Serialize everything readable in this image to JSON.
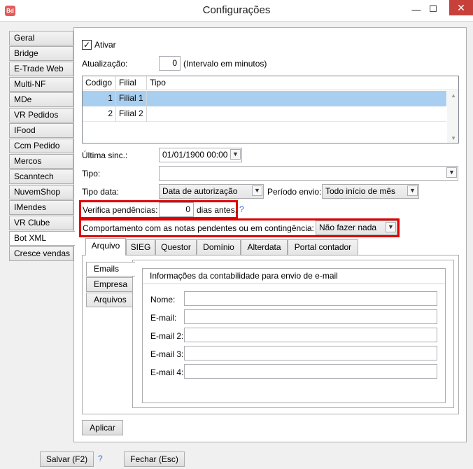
{
  "window": {
    "title": "Configurações",
    "icon_text": "Bd",
    "minimize_glyph": "—",
    "maximize_glyph": "☐",
    "close_glyph": "✕"
  },
  "nav": {
    "items": [
      "Geral",
      "Bridge",
      "E-Trade Web",
      "Multi-NF",
      "MDe",
      "VR Pedidos",
      "IFood",
      "Ccm Pedido",
      "Mercos",
      "Scanntech",
      "NuvemShop",
      "IMendes",
      "VR Clube",
      "Bot XML",
      "Cresce vendas"
    ],
    "active": "Bot XML"
  },
  "form": {
    "ativar_label": "Ativar",
    "ativar_checked": true,
    "check_glyph": "✓",
    "atualizacao_label": "Atualização:",
    "atualizacao_value": "0",
    "atualizacao_hint": "(Intervalo em minutos)",
    "grid": {
      "columns": [
        "Codigo",
        "Filial",
        "Tipo"
      ],
      "rows": [
        {
          "codigo": "1",
          "filial": "Filial 1",
          "tipo": ""
        },
        {
          "codigo": "2",
          "filial": "Filial 2",
          "tipo": ""
        }
      ],
      "selected_row": 0
    },
    "ultima_sinc_label": "Última sinc.:",
    "ultima_sinc_value": "01/01/1900 00:00",
    "tipo_label": "Tipo:",
    "tipo_value": "",
    "tipo_data_label": "Tipo data:",
    "tipo_data_value": "Data de autorização",
    "periodo_envio_label": "Período envio:",
    "periodo_envio_value": "Todo início de mês",
    "verifica_label": "Verifica pendências:",
    "verifica_value": "0",
    "verifica_suffix": "dias antes.",
    "help_glyph": "?",
    "comportamento_label": "Comportamento com as notas pendentes ou em contingência:",
    "comportamento_value": "Não fazer nada",
    "dropdown_glyph": "▼"
  },
  "subtabs": {
    "items": [
      "Arquivo",
      "SIEG",
      "Questor",
      "Domínio",
      "Alterdata",
      "Portal contador"
    ],
    "active": "Arquivo"
  },
  "vtabs": {
    "items": [
      "Emails",
      "Empresa",
      "Arquivos"
    ],
    "active": "Emails"
  },
  "email_group": {
    "title": "Informações da contabilidade para envio de e-mail",
    "fields": [
      {
        "label": "Nome:",
        "value": ""
      },
      {
        "label": "E-mail:",
        "value": ""
      },
      {
        "label": "E-mail 2:",
        "value": ""
      },
      {
        "label": "E-mail 3:",
        "value": ""
      },
      {
        "label": "E-mail 4:",
        "value": ""
      }
    ]
  },
  "buttons": {
    "aplicar": "Aplicar",
    "salvar": "Salvar (F2)",
    "fechar": "Fechar (Esc)"
  },
  "colors": {
    "highlight": "#e00000",
    "selected_row": "#a8cfef",
    "close_button": "#c7403a"
  }
}
